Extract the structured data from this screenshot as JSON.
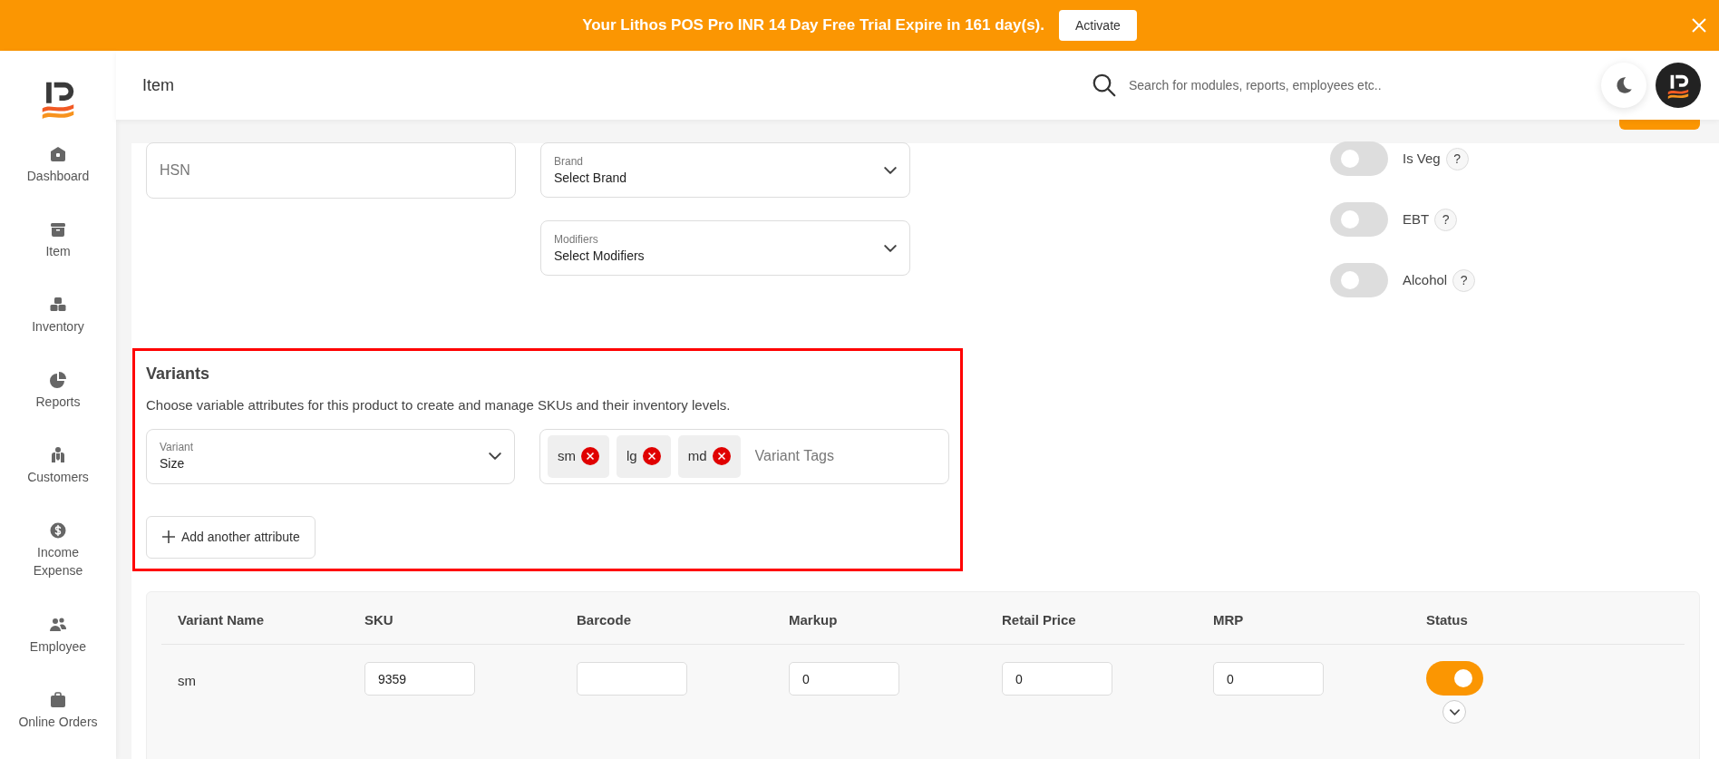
{
  "banner": {
    "message": "Your Lithos POS Pro INR 14 Day Free Trial Expire in 161 day(s).",
    "action": "Activate"
  },
  "header": {
    "title": "Item",
    "search_placeholder": "Search for modules, reports, employees etc.."
  },
  "sidebar": {
    "items": [
      {
        "label": "Dashboard"
      },
      {
        "label": "Item"
      },
      {
        "label": "Inventory"
      },
      {
        "label": "Reports"
      },
      {
        "label": "Customers"
      },
      {
        "label": "Income Expense"
      },
      {
        "label": "Employee"
      },
      {
        "label": "Online Orders"
      }
    ]
  },
  "form": {
    "hsn": {
      "placeholder": "HSN"
    },
    "brand": {
      "label": "Brand",
      "value": "Select Brand"
    },
    "modifiers": {
      "label": "Modifiers",
      "value": "Select Modifiers"
    }
  },
  "flags": [
    {
      "label": "Is Veg",
      "on": false,
      "help": "?"
    },
    {
      "label": "EBT",
      "on": false,
      "help": "?"
    },
    {
      "label": "Alcohol",
      "on": false,
      "help": "?"
    }
  ],
  "variants": {
    "title": "Variants",
    "description": "Choose variable attributes for this product to create and manage SKUs and their inventory levels.",
    "attribute": {
      "label": "Variant",
      "value": "Size"
    },
    "tags": [
      {
        "text": "sm"
      },
      {
        "text": "lg"
      },
      {
        "text": "md"
      }
    ],
    "tags_placeholder": "Variant Tags",
    "add_button": "Add another attribute"
  },
  "table": {
    "columns": [
      "Variant Name",
      "SKU",
      "Barcode",
      "Markup",
      "Retail Price",
      "MRP",
      "Status"
    ],
    "rows": [
      {
        "variant_name": "sm",
        "sku": "9359",
        "markup": "0",
        "retail_price": "0",
        "mrp": "0",
        "status_on": true
      }
    ]
  }
}
